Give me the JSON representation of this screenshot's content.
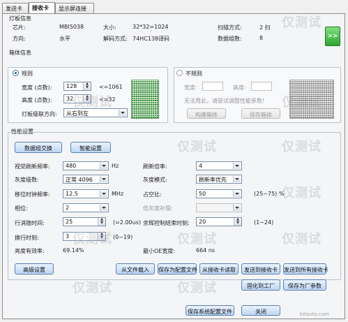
{
  "tabs": [
    "发送卡",
    "接收卡",
    "显示屏连接"
  ],
  "active_tab": 1,
  "board_info": {
    "title": "灯板信息",
    "chip_label": "芯片:",
    "chip_value": "MBI5038",
    "size_label": "大小:",
    "size_value": "32*32=1024",
    "scan_label": "扫描方式:",
    "scan_value": "2 扫",
    "direction_label": "方向:",
    "direction_value": "水平",
    "decode_label": "解码方式:",
    "decode_value": "74HC138译码",
    "groups_label": "数据组数:",
    "groups_value": "8",
    "go_button": ">>"
  },
  "cascade": {
    "title": "箱体信息",
    "regular": {
      "label": "规则",
      "width_label": "宽度 (点数):",
      "width_value": "128",
      "width_hint": "<=1061",
      "height_label": "高度 (点数):",
      "height_value": "32",
      "height_hint": "<=32",
      "cascade_label": "灯板级联方向:",
      "cascade_value": "从右到左"
    },
    "irregular": {
      "label": "不规则",
      "width_label": "宽度:",
      "height_label": "高度:",
      "note": "无法用此，请尝试调整性能参数!",
      "btn_build": "构建箱体",
      "btn_save": "保存箱体"
    }
  },
  "performance": {
    "title": "性能设置",
    "btn_data_group": "数据组交换",
    "btn_smart": "智能设置",
    "refresh_label": "视觉刷新频率:",
    "refresh_value": "480",
    "refresh_unit": "Hz",
    "rate_label": "刷新倍率:",
    "rate_value": "4",
    "gray_label": "灰度级数:",
    "gray_value": "正常 4096",
    "gray_mode_label": "灰度模式:",
    "gray_mode_value": "刷新率优先",
    "shift_label": "移位时钟频率:",
    "shift_value": "12.5",
    "shift_unit": "MHz",
    "duty_label": "占空比:",
    "duty_value": "50",
    "duty_hint": "(25~75) %",
    "phase_label": "相位:",
    "phase_value": "2",
    "low_gray_label": "低灰度补偿:",
    "low_gray_value": "",
    "line_blank_label": "行消隐时间:",
    "line_blank_value": "25",
    "line_blank_hint": "(=2.00us)",
    "afterglow_label": "余辉控制结束时刻:",
    "afterglow_value": "20",
    "afterglow_hint": "(1~24)",
    "line_change_label": "换行时刻:",
    "line_change_value": "3",
    "line_change_hint": "(0~19)",
    "brightness_label": "亮度有效率:",
    "brightness_value": "69.14%",
    "min_ol_label": "最小OE宽度:",
    "min_ol_value": "664 ns"
  },
  "bottom_buttons": {
    "advanced": "高级设置",
    "load_file": "从文件载入",
    "save_file": "保存为配置文件",
    "read_back": "从接收卡读取",
    "send_card": "发送到接收卡",
    "send_all": "发送到所有接收卡",
    "solidify": "固化到工厂",
    "solidify_all": "保存为厂参数",
    "save_system": "保存系统配置文件",
    "close": "关闭"
  },
  "watermark": "仅测试",
  "footer_logo": "bitauto.com",
  "colors": {
    "accent_button": "#bcd6f4",
    "green": "#2ea52e"
  }
}
